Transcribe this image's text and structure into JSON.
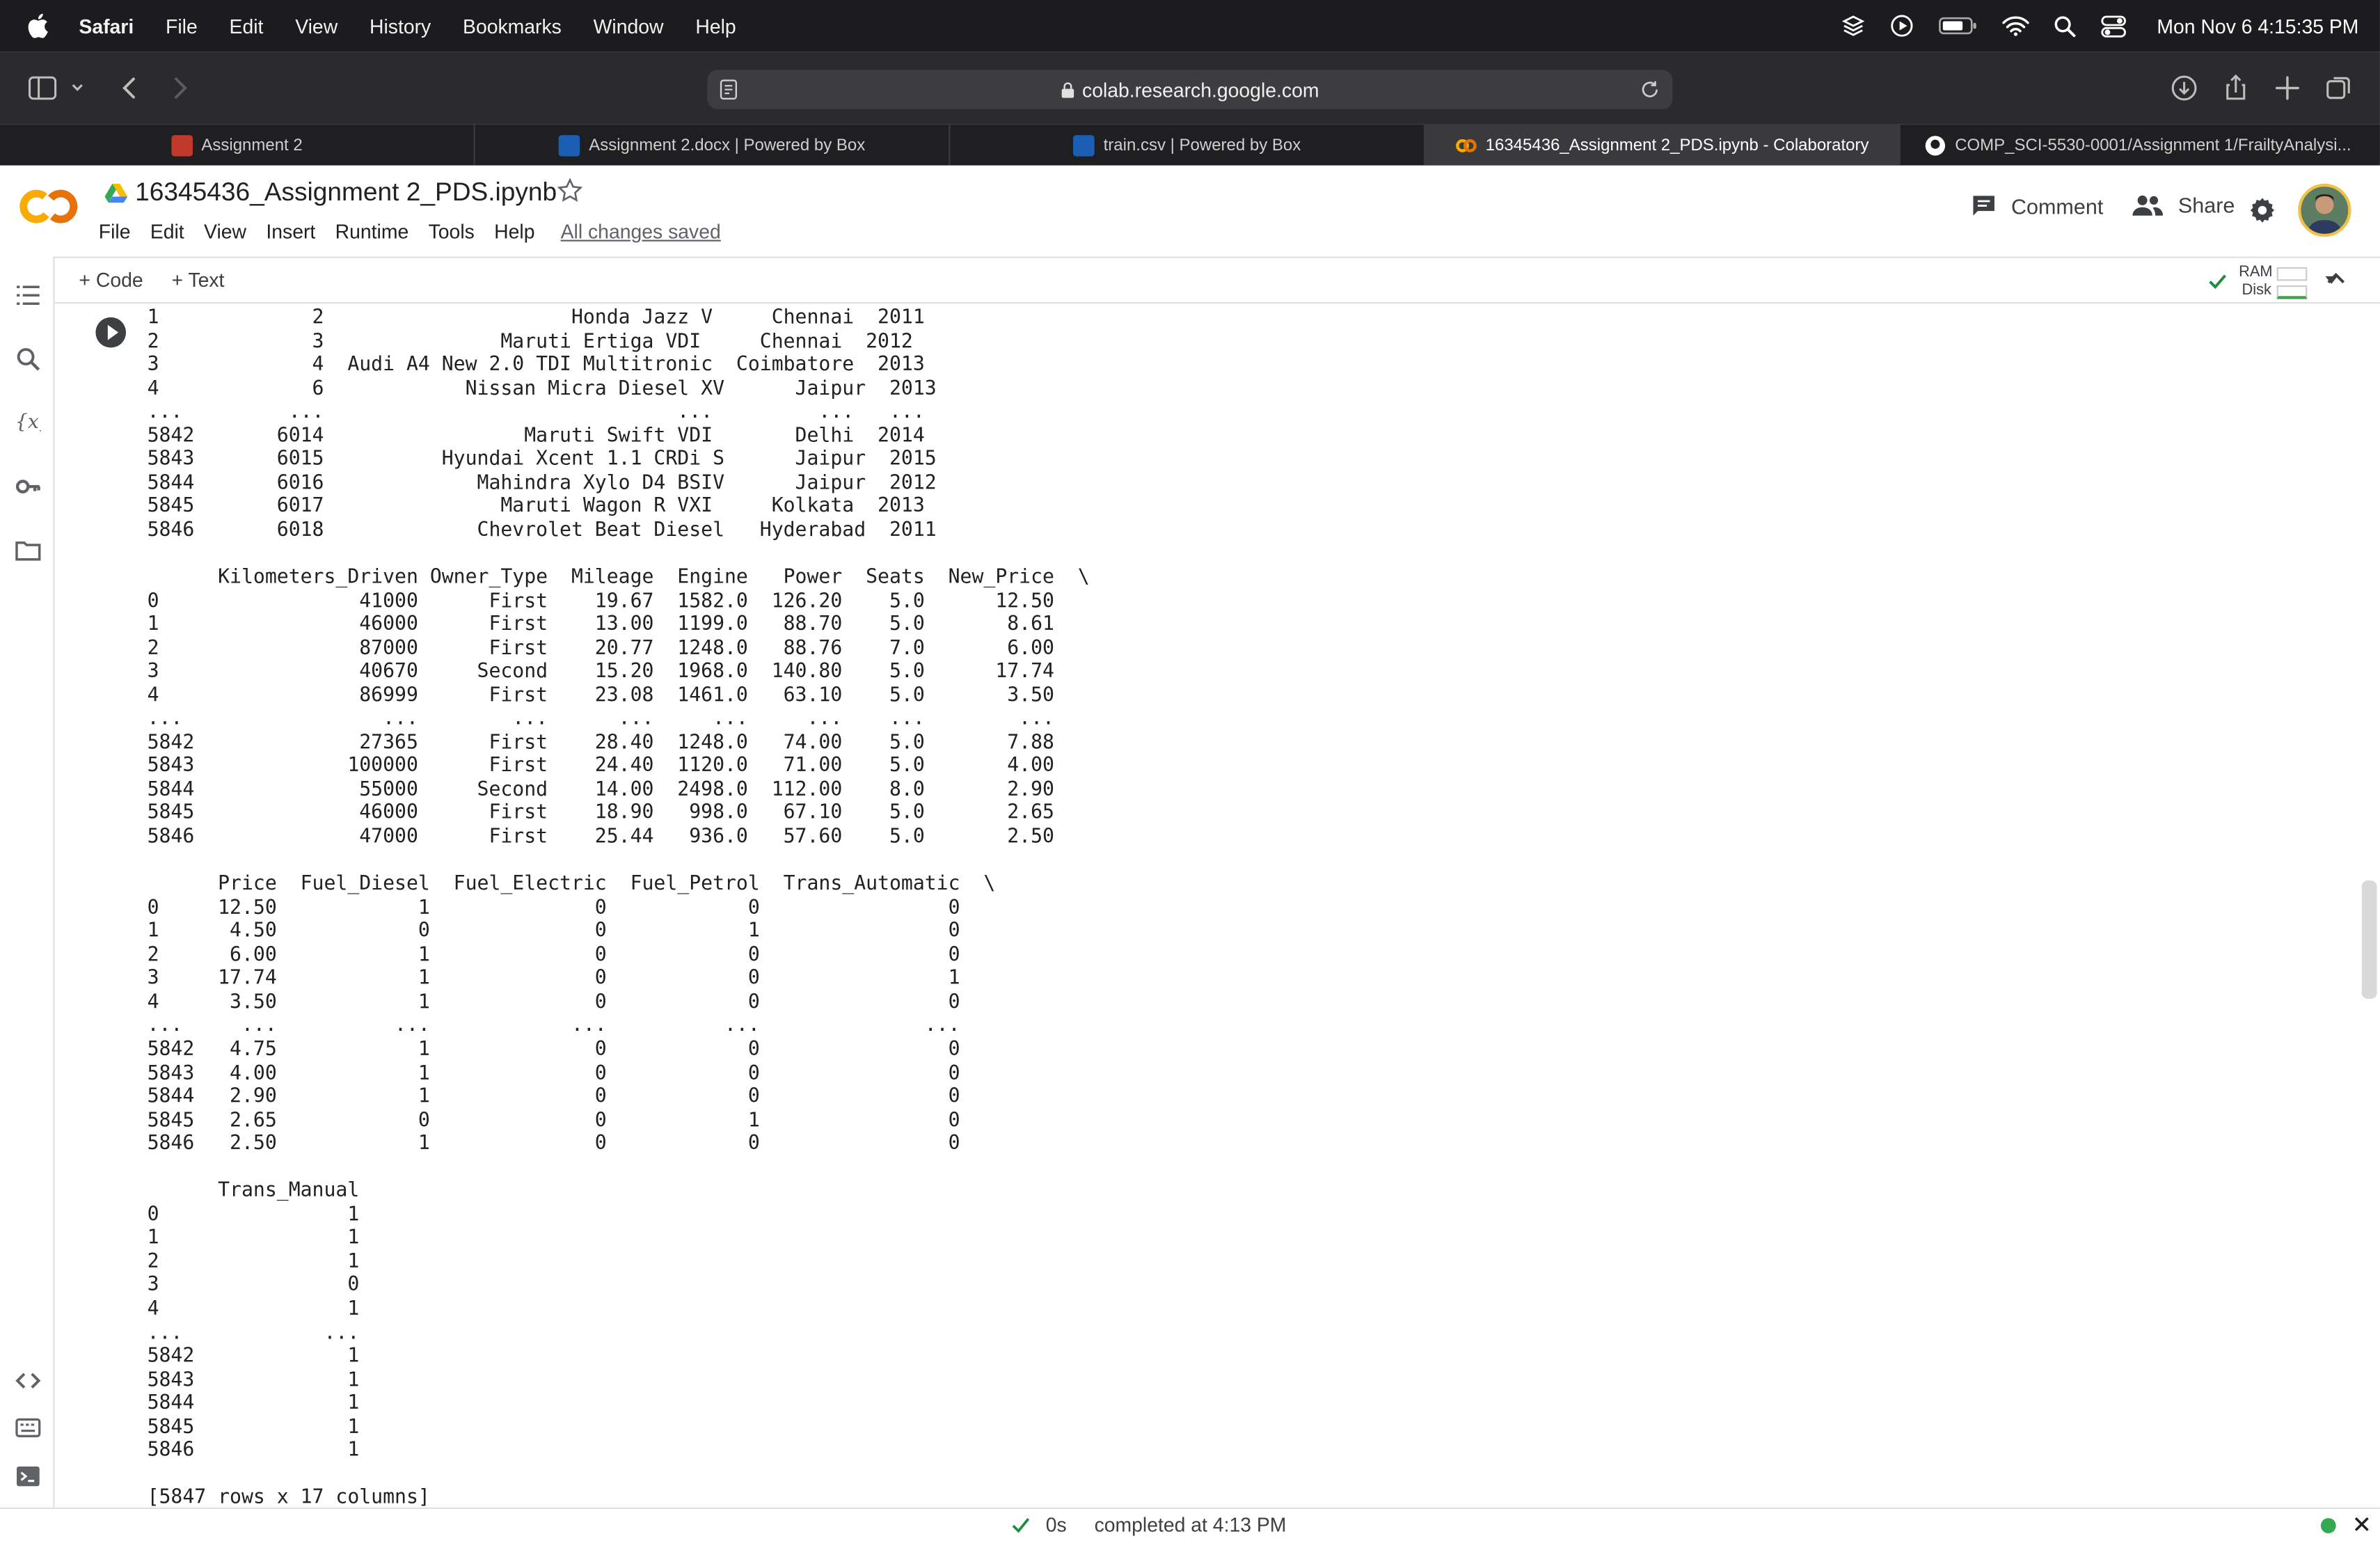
{
  "menubar": {
    "app_name": "Safari",
    "items": [
      "File",
      "Edit",
      "View",
      "History",
      "Bookmarks",
      "Window",
      "Help"
    ],
    "clock": "Mon Nov 6  4:15:35 PM"
  },
  "browser": {
    "url": "colab.research.google.com",
    "tabs": [
      {
        "label": "Assignment 2",
        "icon": "canvas-icon",
        "color": "#c0392b"
      },
      {
        "label": "Assignment 2.docx | Powered by Box",
        "icon": "box-icon",
        "color": "#1a5fb4"
      },
      {
        "label": "train.csv | Powered by Box",
        "icon": "box-icon",
        "color": "#1a5fb4"
      },
      {
        "label": "16345436_Assignment 2_PDS.ipynb - Colaboratory",
        "icon": "colab-icon",
        "color": "#f9ab00"
      },
      {
        "label": "COMP_SCI-5530-0001/Assignment 1/FrailtyAnalysi...",
        "icon": "github-icon",
        "color": "#ffffff"
      }
    ]
  },
  "colab": {
    "title": "16345436_Assignment 2_PDS.ipynb",
    "menu": [
      "File",
      "Edit",
      "View",
      "Insert",
      "Runtime",
      "Tools",
      "Help"
    ],
    "saved_status": "All changes saved",
    "comment_label": "Comment",
    "share_label": "Share",
    "add_code_label": "+ Code",
    "add_text_label": "+ Text",
    "ram_label": "RAM",
    "disk_label": "Disk"
  },
  "output": {
    "text": "1             2                     Honda Jazz V     Chennai  2011   \n2             3               Maruti Ertiga VDI     Chennai  2012   \n3             4  Audi A4 New 2.0 TDI Multitronic  Coimbatore  2013   \n4             6            Nissan Micra Diesel XV      Jaipur  2013   \n...         ...                              ...         ...   ...   \n5842       6014                 Maruti Swift VDI       Delhi  2014   \n5843       6015          Hyundai Xcent 1.1 CRDi S      Jaipur  2015   \n5844       6016             Mahindra Xylo D4 BSIV      Jaipur  2012   \n5845       6017               Maruti Wagon R VXI     Kolkata  2013   \n5846       6018             Chevrolet Beat Diesel   Hyderabad  2011   \n\n      Kilometers_Driven Owner_Type  Mileage  Engine   Power  Seats  New_Price  \\\n0                 41000      First    19.67  1582.0  126.20    5.0      12.50   \n1                 46000      First    13.00  1199.0   88.70    5.0       8.61   \n2                 87000      First    20.77  1248.0   88.76    7.0       6.00   \n3                 40670     Second    15.20  1968.0  140.80    5.0      17.74   \n4                 86999      First    23.08  1461.0   63.10    5.0       3.50   \n...                 ...        ...      ...     ...     ...    ...        ...   \n5842              27365      First    28.40  1248.0   74.00    5.0       7.88   \n5843             100000      First    24.40  1120.0   71.00    5.0       4.00   \n5844              55000     Second    14.00  2498.0  112.00    8.0       2.90   \n5845              46000      First    18.90   998.0   67.10    5.0       2.65   \n5846              47000      First    25.44   936.0   57.60    5.0       2.50   \n\n      Price  Fuel_Diesel  Fuel_Electric  Fuel_Petrol  Trans_Automatic  \\\n0     12.50            1              0            0                0   \n1      4.50            0              0            1                0   \n2      6.00            1              0            0                0   \n3     17.74            1              0            0                1   \n4      3.50            1              0            0                0   \n...     ...          ...            ...          ...              ...   \n5842   4.75            1              0            0                0   \n5843   4.00            1              0            0                0   \n5844   2.90            1              0            0                0   \n5845   2.65            0              0            1                0   \n5846   2.50            1              0            0                0   \n\n      Trans_Manual  \n0                1  \n1                1  \n2                1  \n3                0  \n4                1  \n...            ...  \n5842             1  \n5843             1  \n5844             1  \n5845             1  \n5846             1  \n\n[5847 rows x 17 columns]"
  },
  "statusbar": {
    "elapsed": "0s",
    "completed": "completed at 4:13 PM"
  }
}
